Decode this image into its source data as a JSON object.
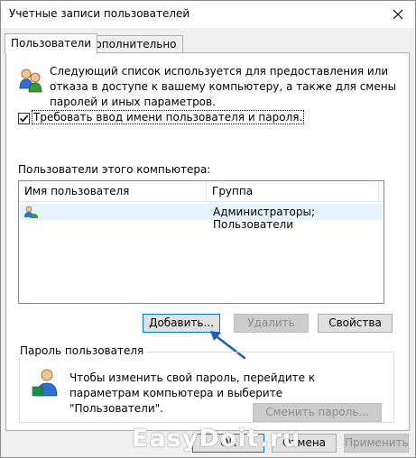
{
  "window": {
    "title": "Учетные записи пользователей",
    "close_icon": "close-icon"
  },
  "tabs": [
    {
      "label": "Пользователи",
      "active": true
    },
    {
      "label": "Дополнительно",
      "active": false
    }
  ],
  "users_tab": {
    "description": "Следующий список используется для предоставления или отказа в доступе к вашему компьютеру, а также для смены паролей и иных параметров.",
    "require_login_checkbox": {
      "label": "Требовать ввод имени пользователя и пароля.",
      "checked": true
    },
    "users_list_label": "Пользователи этого компьютера:",
    "table": {
      "columns": [
        "Имя пользователя",
        "Группа"
      ],
      "rows": [
        {
          "name": "",
          "group": "Администраторы; Пользователи",
          "icon": "user-icon"
        }
      ]
    },
    "buttons": {
      "add": "Добавить...",
      "remove": "Удалить",
      "properties": "Свойства"
    },
    "password_group": {
      "title": "Пароль пользователя",
      "text": "Чтобы изменить свой пароль, перейдите к параметрам компьютера и выберите \"Пользователи\".",
      "change_button": "Сменить пароль..."
    }
  },
  "footer": {
    "ok": "ОК",
    "cancel": "Отмена",
    "apply": "Применить"
  },
  "watermark": "EasyDoit.ru",
  "colors": {
    "accent": "#0078d7",
    "arrow": "#1f5fb0",
    "selection": "#e5f3ff"
  }
}
